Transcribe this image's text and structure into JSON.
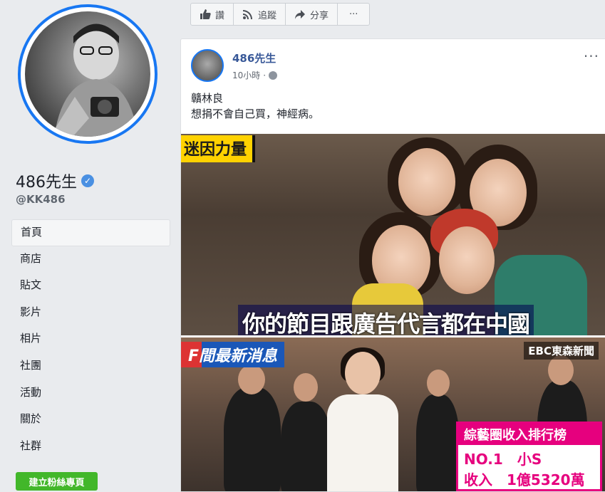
{
  "profile": {
    "name": "486先生",
    "handle": "@KK486"
  },
  "nav": {
    "items": [
      "首頁",
      "商店",
      "貼文",
      "影片",
      "相片",
      "社團",
      "活動",
      "關於",
      "社群"
    ],
    "active_index": 0
  },
  "create_page_label": "建立粉絲專頁",
  "actions": {
    "like": "讚",
    "follow": "追蹤",
    "share": "分享",
    "more": "···"
  },
  "post": {
    "author": "486先生",
    "time": "10小時",
    "more": "···",
    "line1": "贛林良",
    "line2": "想捐不會自己買，神經病。"
  },
  "image1": {
    "tag": "迷因力量",
    "subtitle": "你的節目跟廣告代言都在中國"
  },
  "image2": {
    "tag": "F間最新消息",
    "logo": "EBC東森新聞",
    "rank_title": "綜藝圈收入排行榜",
    "rank_line1": "NO.1　小S",
    "rank_line2": "收入　1億5320萬"
  },
  "colors": {
    "accent": "#1877f2",
    "link": "#385898",
    "green": "#42b72a",
    "magenta": "#e6007e"
  }
}
